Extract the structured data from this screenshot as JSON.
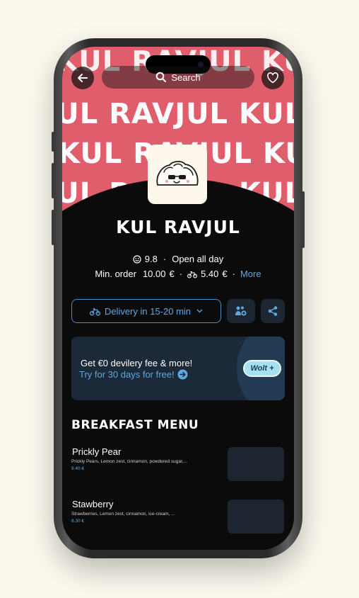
{
  "header": {
    "search_placeholder": "Search",
    "hero_pattern_text": "KUL RAVJUL"
  },
  "venue": {
    "name": "KUL RAVJUL",
    "rating": "9.8",
    "separator": "·",
    "hours": "Open all day",
    "min_order_label": "Min. order",
    "min_order_value": "10.00",
    "currency": "€",
    "delivery_fee": "5.40",
    "more_link": "More"
  },
  "actions": {
    "delivery_label": "Delivery in 15-20 min"
  },
  "promo": {
    "title": "Get €0 devilery fee & more!",
    "link": "Try for 30 days for free!",
    "badge": "Wolt +"
  },
  "menu": {
    "section_title": "BREAKFAST MENU",
    "items": [
      {
        "name": "Prickly Pear",
        "description": "Prickly Pears, Lemon zest, cinnamon, powdered sugar,...",
        "price": "9.40 €"
      },
      {
        "name": "Stawberry",
        "description": "Strawberries, Lemon zest, cinnamon, ice-cream, ...",
        "price": "8.30 €"
      }
    ]
  },
  "colors": {
    "hero_background": "#e05d6c",
    "accent_blue": "#5ea8e0",
    "screen_background": "#0b0b0b",
    "page_background": "#fbf9ee"
  }
}
